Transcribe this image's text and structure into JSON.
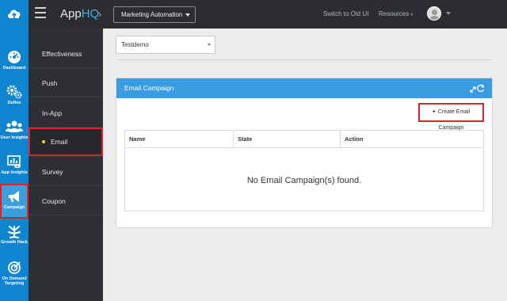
{
  "header": {
    "app_name_prefix": "App",
    "app_name_suffix": "HQ",
    "breadcrumb_separator": "›",
    "context_select": "Marketing Automation",
    "switch_link": "Switch to Old UI",
    "resources_link": "Resources",
    "resources_caret": "▾"
  },
  "icon_sidebar": {
    "items": [
      {
        "label": "Dashboard",
        "icon": "dashboard-icon"
      },
      {
        "label": "Define",
        "icon": "gears-icon"
      },
      {
        "label": "User Insights",
        "icon": "users-icon"
      },
      {
        "label": "App Insights",
        "icon": "app-insights-icon"
      },
      {
        "label": "Campaign",
        "icon": "megaphone-icon",
        "active": true
      },
      {
        "label": "Growth Hack",
        "icon": "growth-hack-icon"
      },
      {
        "label_line1": "On Demand",
        "label_line2": "Targeting",
        "icon": "target-icon"
      }
    ]
  },
  "sub_nav": {
    "items": [
      "Effectiveness",
      "Push",
      "In-App",
      "Email",
      "Survey",
      "Coupon"
    ],
    "active": "Email"
  },
  "app_select": {
    "value": "Testdemo"
  },
  "panel": {
    "title": "Email Campaign",
    "create_button": "Create Email Campaign",
    "columns": [
      "Name",
      "State",
      "Action"
    ],
    "empty_message": "No Email Campaign(s) found."
  },
  "colors": {
    "brand_blue": "#0f85cf",
    "panel_header": "#3a9ce0",
    "highlight_red": "#d9232d",
    "nav_dark": "#2e3035",
    "active_dot": "#f3d433"
  }
}
